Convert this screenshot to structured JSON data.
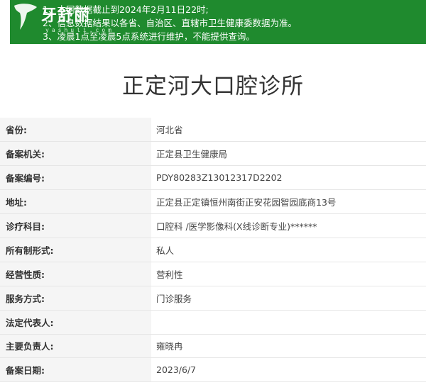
{
  "watermark": {
    "text": "牙舒丽",
    "sub": "yashuli.com"
  },
  "notice": {
    "lines": [
      "1、本网数据截止到2024年2月11日22时;",
      "2、信息数据结果以各省、自治区、直辖市卫生健康委数据为准。",
      "3、凌晨1点至凌晨5点系统进行维护，不能提供查询。"
    ]
  },
  "clinic": {
    "name": "正定河大口腔诊所"
  },
  "rows": [
    {
      "label": "省份:",
      "value": "河北省"
    },
    {
      "label": "备案机关:",
      "value": "正定县卫生健康局"
    },
    {
      "label": "备案编号:",
      "value": "PDY80283Z13012317D2202"
    },
    {
      "label": "地址:",
      "value": "正定县正定镇恒州南街正安花园智园底商13号"
    },
    {
      "label": "诊疗科目:",
      "value": "口腔科 /医学影像科(X线诊断专业)******"
    },
    {
      "label": "所有制形式:",
      "value": "私人"
    },
    {
      "label": "经营性质:",
      "value": "营利性"
    },
    {
      "label": "服务方式:",
      "value": "门诊服务"
    },
    {
      "label": "法定代表人:",
      "value": ""
    },
    {
      "label": "主要负责人:",
      "value": "雍晓冉"
    },
    {
      "label": "备案日期:",
      "value": "2023/6/7"
    }
  ],
  "colors": {
    "notice_bg": "#1f8a2e",
    "label_bg": "#f5f5f5"
  }
}
